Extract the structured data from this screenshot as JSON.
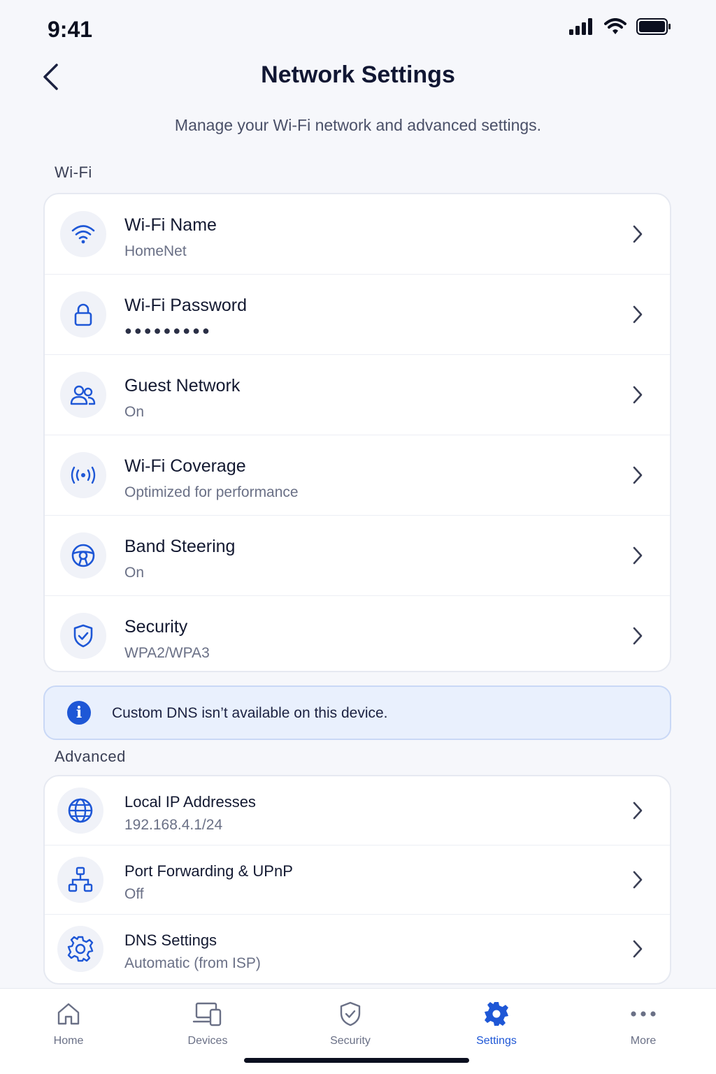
{
  "status": {
    "time": "9:41"
  },
  "header": {
    "title": "Network Settings",
    "subtitle": "Manage your Wi-Fi network and advanced settings."
  },
  "sections": {
    "wifi": {
      "title": "Wi-Fi",
      "items": [
        {
          "label": "Wi-Fi Name",
          "value": "HomeNet",
          "icon": "wifi-icon"
        },
        {
          "label": "Wi-Fi Password",
          "value": "●●●●●●●●●",
          "icon": "lock-icon"
        },
        {
          "label": "Guest Network",
          "value": "On",
          "icon": "users-icon"
        },
        {
          "label": "Wi-Fi Coverage",
          "value": "Optimized for performance",
          "icon": "broadcast-icon"
        },
        {
          "label": "Band Steering",
          "value": "On",
          "icon": "steering-wheel-icon"
        },
        {
          "label": "Security",
          "value": "WPA2/WPA3",
          "icon": "shield-check-icon"
        }
      ]
    },
    "notice": {
      "text": "Custom DNS isn’t available on this device.",
      "icon_text": "i"
    },
    "advanced": {
      "title": "Advanced",
      "items": [
        {
          "label": "Local IP Addresses",
          "value": "192.168.4.1/24",
          "icon": "globe-icon"
        },
        {
          "label": "Port Forwarding & UPnP",
          "value": "Off",
          "icon": "network-tree-icon"
        },
        {
          "label": "DNS Settings",
          "value": "Automatic (from ISP)",
          "icon": "gear-icon"
        }
      ]
    }
  },
  "tabs": [
    {
      "label": "Home",
      "icon": "home-icon",
      "active": false
    },
    {
      "label": "Devices",
      "icon": "devices-icon",
      "active": false
    },
    {
      "label": "Security",
      "icon": "shield-icon",
      "active": false
    },
    {
      "label": "Settings",
      "icon": "gear-icon",
      "active": true
    },
    {
      "label": "More",
      "icon": "more-icon",
      "active": false
    }
  ],
  "colors": {
    "accent": "#1e57d6",
    "text": "#131931",
    "muted": "#6a7086",
    "background": "#f6f7fb"
  }
}
